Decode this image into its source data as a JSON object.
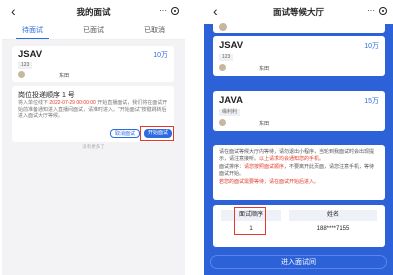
{
  "left_screen": {
    "nav": {
      "back": "‹",
      "title": "我的面试",
      "more": "···"
    },
    "tabs": [
      {
        "label": "待面试",
        "active": true
      },
      {
        "label": "已面试",
        "active": false
      },
      {
        "label": "已取消",
        "active": false
      }
    ],
    "job_card": {
      "title": "JSAV",
      "salary": "10万",
      "tag": "123",
      "company": "东田"
    },
    "queue_card": {
      "heading": "岗位投递顺序 1 号",
      "notice_part1": "将入单位线下 ",
      "notice_time": "2022-07-29 00:00:00",
      "notice_part2": " 开始直播面试，我们",
      "notice_rest": "将在面试开始前准备通知进入直播间面试，请准时进入。\"开始面试\"按键跳转后进入面试大厅等候。",
      "leave_button": "取消面试",
      "start_button": "开始面试"
    },
    "no_more": "没有更多了"
  },
  "right_screen": {
    "nav": {
      "back": "‹",
      "title": "面试等候大厅",
      "more": "···"
    },
    "jobs": [
      {
        "title": "JSAV",
        "salary": "10万",
        "tag": "123",
        "company": "东田"
      },
      {
        "title": "JAVA",
        "salary": "15万",
        "tag": "缘利利",
        "company": "东田"
      }
    ],
    "rules": {
      "p1": "请在面试等候大厅内等待，请勿退出小程序，当轮到我面试时会出现提示，请注意接听。",
      "p1_red": "以上请求均会通知您的手机。",
      "p2": "面试排序：",
      "p2_red": "请您按照面试顺序",
      "p2_rest": "，不要离开此页面，请您注意手机，等待面试开始。",
      "p3_red": "若您的面试需要等待，请在面试开始后进入。"
    },
    "queue_table": {
      "headers": [
        "面试顺序",
        "姓名"
      ],
      "row": [
        "1",
        "188****7155"
      ]
    },
    "enter_button": "进入面试间"
  },
  "colors": {
    "accent": "#2c6be0",
    "highlight_box": "#e23b2a",
    "hall_background": "#2c61d8"
  }
}
